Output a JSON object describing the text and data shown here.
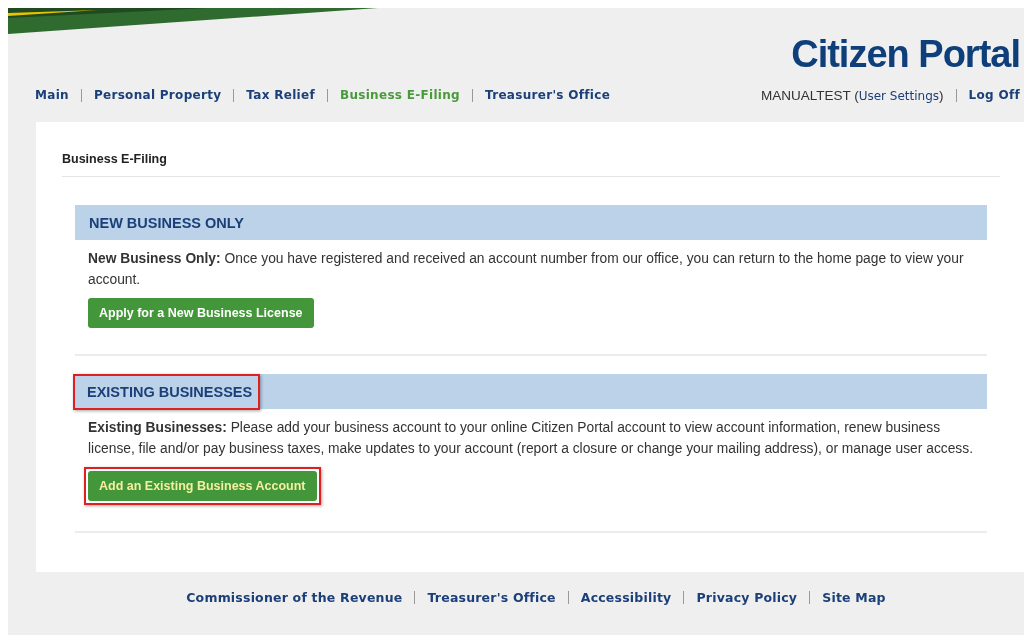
{
  "header": {
    "title": "Citizen Portal"
  },
  "nav": [
    {
      "label": "Main",
      "selected": false
    },
    {
      "label": "Personal Property",
      "selected": false
    },
    {
      "label": "Tax Relief",
      "selected": false
    },
    {
      "label": "Business E-Filing",
      "selected": true
    },
    {
      "label": "Treasurer's Office",
      "selected": false
    }
  ],
  "user": {
    "prefix": "MANUALTEST (",
    "link": "User Settings",
    "suffix": ")",
    "logoff": "Log Off"
  },
  "page_title": "Business E-Filing",
  "sections": [
    {
      "heading": "NEW BUSINESS ONLY",
      "highlighted": false,
      "text": "**New Business Only:** Once you have registered and received an account number from our office, you can return to the home page to view your account.",
      "button": {
        "label": "Apply for a New Business License",
        "highlighted": false
      }
    },
    {
      "heading": "EXISTING BUSINESSES",
      "highlighted": true,
      "text": "**Existing Businesses:** Please add your business account to your online Citizen Portal account to view account information, renew business license, file and/or pay business taxes, make updates to your account (report a closure or change your mailing address), or manage user access.",
      "button": {
        "label": "Add an Existing Business Account",
        "highlighted": true
      }
    }
  ],
  "footer": [
    "Commissioner of the Revenue",
    "Treasurer's Office",
    "Accessibility",
    "Privacy Policy",
    "Site Map"
  ]
}
